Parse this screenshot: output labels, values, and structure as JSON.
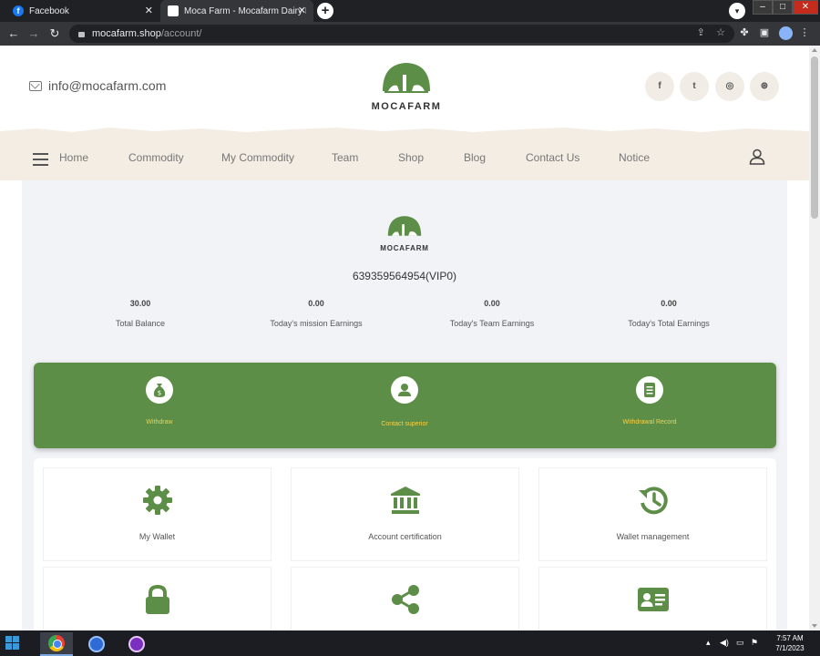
{
  "browser": {
    "tabs": [
      {
        "title": "Facebook",
        "icon": "facebook-icon"
      },
      {
        "title": "Moca Farm - Mocafarm Dairy Inc",
        "icon": "mocafarm-favicon"
      }
    ],
    "url_host": "mocafarm.shop",
    "url_path": "/account/"
  },
  "header": {
    "email": "info@mocafarm.com",
    "logo_text": "MOCAFARM",
    "social": [
      "facebook-icon",
      "twitter-icon",
      "instagram-icon",
      "dribbble-icon"
    ]
  },
  "nav": {
    "items": [
      "Home",
      "Commodity",
      "My Commodity",
      "Team",
      "Shop",
      "Blog",
      "Contact Us",
      "Notice"
    ]
  },
  "account": {
    "logo_text": "MOCAFARM",
    "id": "639359564954(VIP0)",
    "stats": [
      {
        "value": "30.00",
        "label": "Total Balance"
      },
      {
        "value": "0.00",
        "label": "Today's mission Earnings"
      },
      {
        "value": "0.00",
        "label": "Today's Team Earnings"
      },
      {
        "value": "0.00",
        "label": "Today's Total Earnings"
      }
    ]
  },
  "actions": [
    {
      "label": "Withdraw",
      "icon": "money-bag-icon"
    },
    {
      "label": "Contact superior",
      "icon": "user-circle-icon"
    },
    {
      "label": "Withdrawal Record",
      "icon": "document-icon"
    }
  ],
  "menu": [
    {
      "label": "My Wallet",
      "icon": "gear-icon"
    },
    {
      "label": "Account certification",
      "icon": "bank-icon"
    },
    {
      "label": "Wallet management",
      "icon": "history-icon"
    },
    {
      "label": "",
      "icon": "lock-icon"
    },
    {
      "label": "",
      "icon": "share-icon"
    },
    {
      "label": "",
      "icon": "id-card-icon"
    }
  ],
  "taskbar": {
    "time": "7:57 AM",
    "date": "7/1/2023"
  },
  "colors": {
    "brand_green": "#5d8e47",
    "accent_yellow": "#f5d14a",
    "nav_bg": "#f3ede4"
  }
}
